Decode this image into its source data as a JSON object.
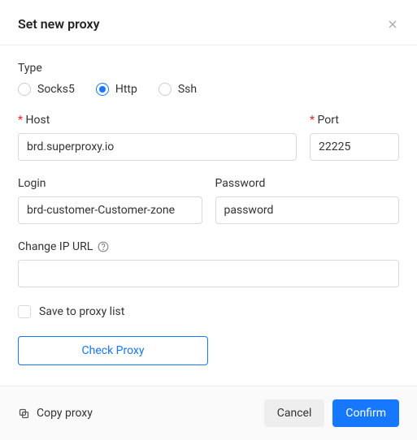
{
  "header": {
    "title": "Set new proxy"
  },
  "type": {
    "label": "Type",
    "options": {
      "socks5": "Socks5",
      "http": "Http",
      "ssh": "Ssh"
    },
    "selected": "http"
  },
  "host": {
    "label": "Host",
    "value": "brd.superproxy.io"
  },
  "port": {
    "label": "Port",
    "value": "22225"
  },
  "login": {
    "label": "Login",
    "value": "brd-customer-Customer-zone"
  },
  "password": {
    "label": "Password",
    "value": "password"
  },
  "change_ip": {
    "label": "Change IP URL",
    "value": ""
  },
  "save_list": {
    "label": "Save to proxy list",
    "checked": false
  },
  "buttons": {
    "check_proxy": "Check Proxy",
    "copy_proxy": "Copy proxy",
    "cancel": "Cancel",
    "confirm": "Confirm"
  }
}
